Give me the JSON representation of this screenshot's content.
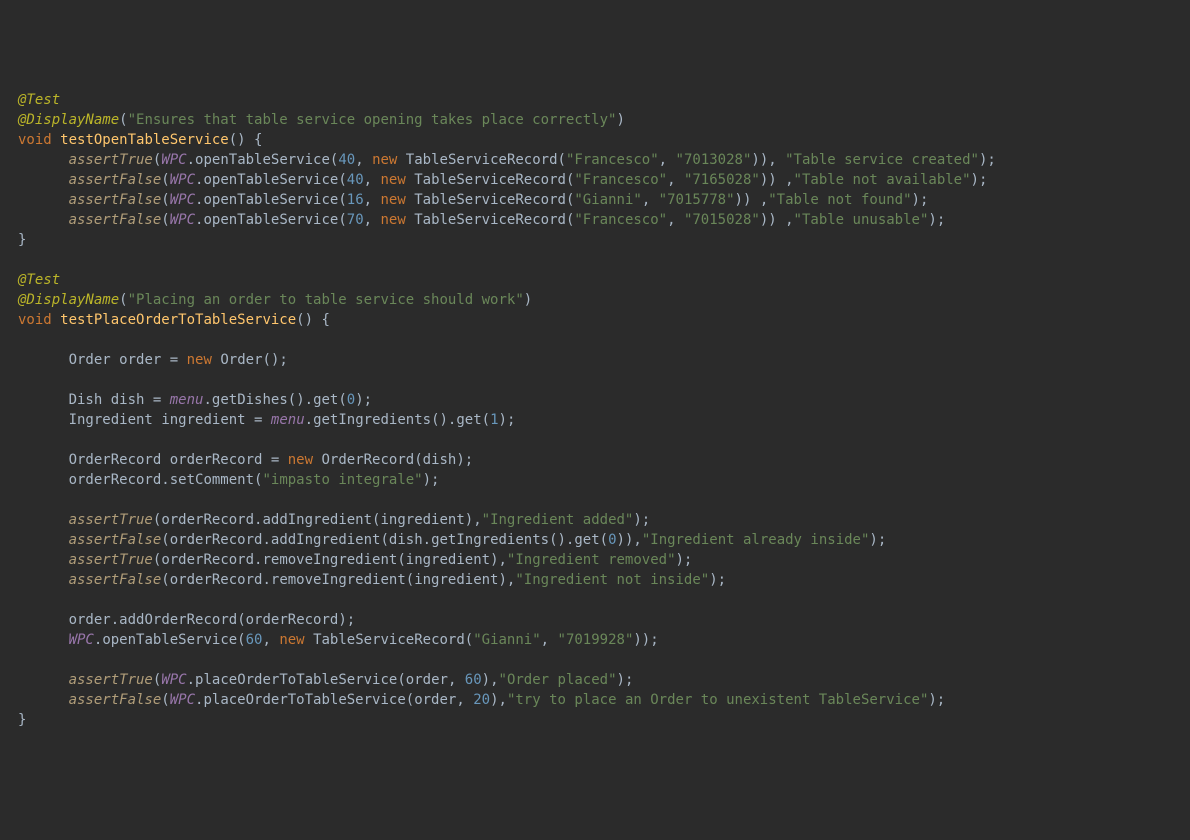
{
  "test1": {
    "ann_test": "@Test",
    "ann_disp": "@DisplayName",
    "disp_str": "\"Ensures that table service opening takes place correctly\"",
    "void": "void",
    "name": "testOpenTableService",
    "assertTrue": "assertTrue",
    "assertFalse": "assertFalse",
    "WPC": "WPC",
    "open": "openTableService",
    "new": "new",
    "TSR": "TableServiceRecord",
    "l1": {
      "n": "40",
      "nm": "\"Francesco\"",
      "ph": "\"7013028\"",
      "msg": "\"Table service created\""
    },
    "l2": {
      "n": "40",
      "nm": "\"Francesco\"",
      "ph": "\"7165028\"",
      "msg": "\"Table not available\""
    },
    "l3": {
      "n": "16",
      "nm": "\"Gianni\"",
      "ph": "\"7015778\"",
      "msg": "\"Table not found\""
    },
    "l4": {
      "n": "70",
      "nm": "\"Francesco\"",
      "ph": "\"7015028\"",
      "msg": "\"Table unusable\""
    }
  },
  "test2": {
    "ann_test": "@Test",
    "ann_disp": "@DisplayName",
    "disp_str": "\"Placing an order to table service should work\"",
    "void": "void",
    "name": "testPlaceOrderToTableService",
    "Order": "Order",
    "order": "order",
    "new": "new",
    "Dish": "Dish",
    "dish": "dish",
    "menu": "menu",
    "getDishes": "getDishes",
    "get": "get",
    "zero": "0",
    "Ingredient": "Ingredient",
    "ingredient": "ingredient",
    "getIngredients": "getIngredients",
    "one": "1",
    "OrderRecord": "OrderRecord",
    "orderRecord": "orderRecord",
    "setComment": "setComment",
    "comment_str": "\"impasto integrale\"",
    "assertTrue": "assertTrue",
    "assertFalse": "assertFalse",
    "addIngredient": "addIngredient",
    "removeIngredient": "removeIngredient",
    "msg_add": "\"Ingredient added\"",
    "msg_already": "\"Ingredient already inside\"",
    "msg_removed": "\"Ingredient removed\"",
    "msg_notinside": "\"Ingredient not inside\"",
    "addOrderRecord": "addOrderRecord",
    "WPC": "WPC",
    "open": "openTableService",
    "n60": "60",
    "TSR": "TableServiceRecord",
    "gianni": "\"Gianni\"",
    "ph": "\"7019928\"",
    "placeOrder": "placeOrderToTableService",
    "n20": "20",
    "msg_placed": "\"Order placed\"",
    "msg_unex": "\"try to place an Order to unexistent TableService\""
  }
}
